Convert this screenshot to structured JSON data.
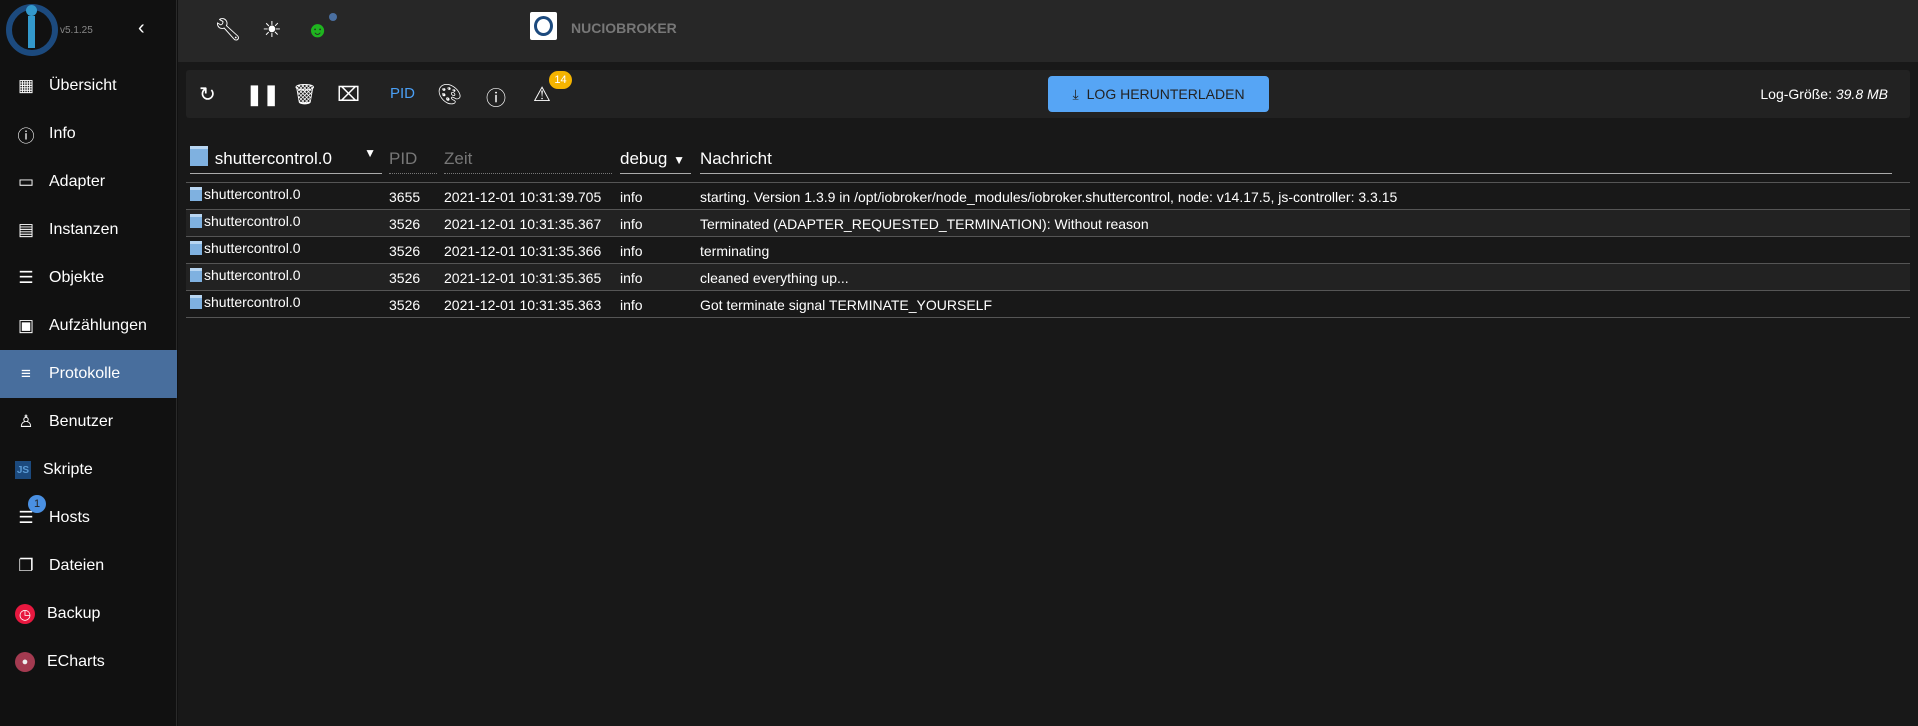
{
  "app": {
    "version": "v5.1.25",
    "host_name": "NUCIOBROKER"
  },
  "sidebar": {
    "items": [
      {
        "label": "Übersicht",
        "icon": "grid-icon"
      },
      {
        "label": "Info",
        "icon": "info-icon"
      },
      {
        "label": "Adapter",
        "icon": "store-icon"
      },
      {
        "label": "Instanzen",
        "icon": "subtitles-icon"
      },
      {
        "label": "Objekte",
        "icon": "list-icon"
      },
      {
        "label": "Aufzählungen",
        "icon": "card-icon"
      },
      {
        "label": "Protokolle",
        "icon": "lines-icon",
        "active": true
      },
      {
        "label": "Benutzer",
        "icon": "user-icon"
      },
      {
        "label": "Skripte",
        "icon": "js-icon"
      },
      {
        "label": "Hosts",
        "icon": "server-icon",
        "badge": "1"
      },
      {
        "label": "Dateien",
        "icon": "files-icon"
      },
      {
        "label": "Backup",
        "icon": "backup-icon"
      },
      {
        "label": "ECharts",
        "icon": "echarts-icon"
      }
    ]
  },
  "toolbar": {
    "pid_label": "PID",
    "warning_count": "14",
    "download_label": "LOG HERUNTERLADEN",
    "log_size_label": "Log-Größe:",
    "log_size_value": "39.8 MB"
  },
  "table": {
    "filters": {
      "source": "shuttercontrol.0",
      "pid_placeholder": "PID",
      "time_placeholder": "Zeit",
      "level": "debug",
      "message_header": "Nachricht"
    },
    "rows": [
      {
        "source": "shuttercontrol.0",
        "pid": "3655",
        "time": "2021-12-01 10:31:39.705",
        "level": "info",
        "message": "starting. Version 1.3.9 in /opt/iobroker/node_modules/iobroker.shuttercontrol, node: v14.17.5, js-controller: 3.3.15"
      },
      {
        "source": "shuttercontrol.0",
        "pid": "3526",
        "time": "2021-12-01 10:31:35.367",
        "level": "info",
        "message": "Terminated (ADAPTER_REQUESTED_TERMINATION): Without reason"
      },
      {
        "source": "shuttercontrol.0",
        "pid": "3526",
        "time": "2021-12-01 10:31:35.366",
        "level": "info",
        "message": "terminating"
      },
      {
        "source": "shuttercontrol.0",
        "pid": "3526",
        "time": "2021-12-01 10:31:35.365",
        "level": "info",
        "message": "cleaned everything up..."
      },
      {
        "source": "shuttercontrol.0",
        "pid": "3526",
        "time": "2021-12-01 10:31:35.363",
        "level": "info",
        "message": "Got terminate signal TERMINATE_YOURSELF"
      }
    ]
  }
}
